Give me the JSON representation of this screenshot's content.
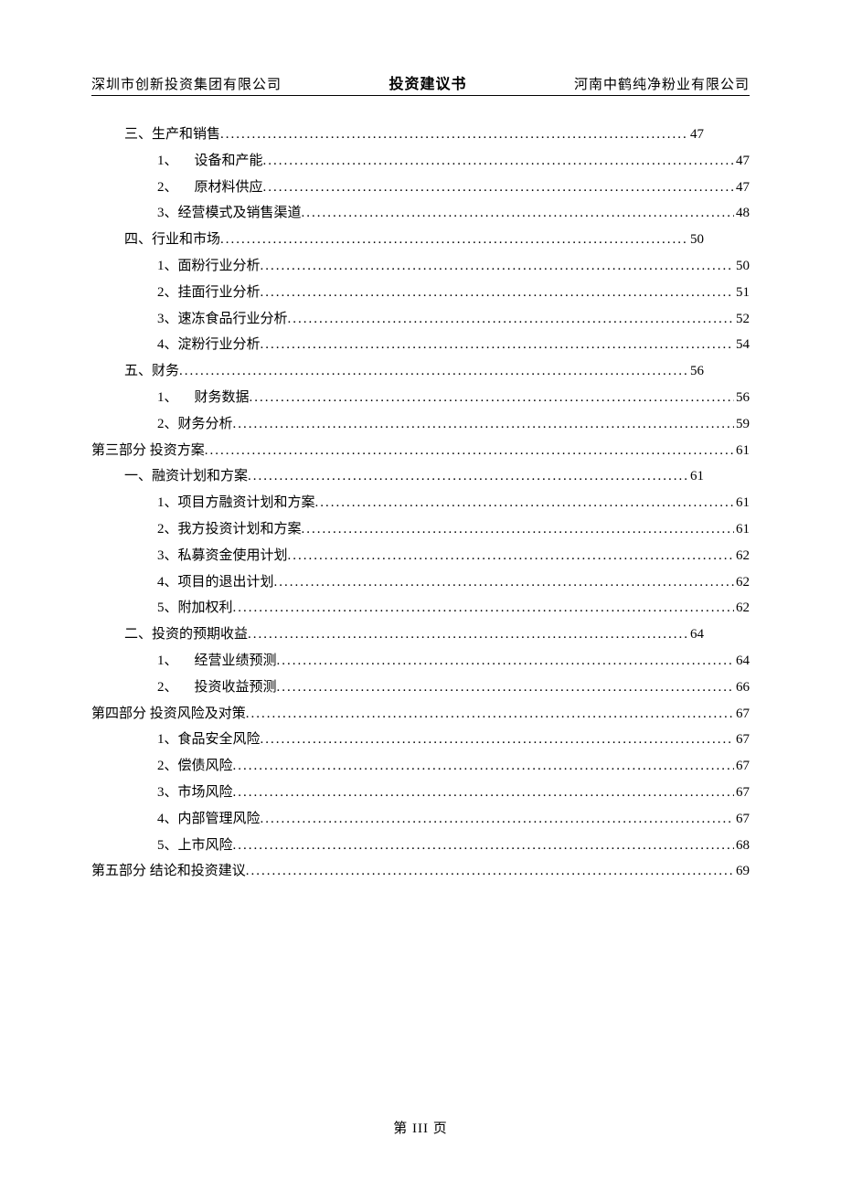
{
  "header": {
    "left": "深圳市创新投资集团有限公司",
    "center": "投资建议书",
    "right": "河南中鹤纯净粉业有限公司"
  },
  "toc": [
    {
      "indent": 1,
      "short": true,
      "label": "三、生产和销售",
      "page": "47"
    },
    {
      "indent": 2,
      "short": false,
      "sep": true,
      "label_prefix": "1、",
      "label": "设备和产能",
      "page": "47"
    },
    {
      "indent": 2,
      "short": false,
      "sep": true,
      "label_prefix": "2、",
      "label": "原材料供应",
      "page": "47"
    },
    {
      "indent": 2,
      "short": false,
      "label": "3、经营模式及销售渠道",
      "page": "48"
    },
    {
      "indent": 1,
      "short": true,
      "label": "四、行业和市场",
      "page": "50"
    },
    {
      "indent": 2,
      "short": false,
      "label": "1、面粉行业分析",
      "page": "50"
    },
    {
      "indent": 2,
      "short": false,
      "label": "2、挂面行业分析",
      "page": "51"
    },
    {
      "indent": 2,
      "short": false,
      "label": "3、速冻食品行业分析",
      "page": "52"
    },
    {
      "indent": 2,
      "short": false,
      "label": "4、淀粉行业分析",
      "page": "54"
    },
    {
      "indent": 1,
      "short": true,
      "label": "五、财务",
      "page": "56"
    },
    {
      "indent": 2,
      "short": false,
      "sep": true,
      "label_prefix": "1、",
      "label": "财务数据",
      "page": "56"
    },
    {
      "indent": 2,
      "short": false,
      "label": "2、财务分析",
      "page": "59"
    },
    {
      "indent": 0,
      "short": false,
      "label": "第三部分  投资方案",
      "page": "61"
    },
    {
      "indent": 1,
      "short": true,
      "label": "一、融资计划和方案",
      "page": "61"
    },
    {
      "indent": 2,
      "short": false,
      "label": "1、项目方融资计划和方案",
      "page": "61"
    },
    {
      "indent": 2,
      "short": false,
      "label": "2、我方投资计划和方案",
      "page": "61"
    },
    {
      "indent": 2,
      "short": false,
      "label": "3、私募资金使用计划",
      "page": "62"
    },
    {
      "indent": 2,
      "short": false,
      "label": "4、项目的退出计划",
      "page": "62"
    },
    {
      "indent": 2,
      "short": false,
      "label": "5、附加权利",
      "page": "62"
    },
    {
      "indent": 1,
      "short": true,
      "label": "二、投资的预期收益",
      "page": "64"
    },
    {
      "indent": 2,
      "short": false,
      "sep": true,
      "label_prefix": "1、",
      "label": "经营业绩预测",
      "page": "64"
    },
    {
      "indent": 2,
      "short": false,
      "sep": true,
      "label_prefix": "2、",
      "label": "投资收益预测",
      "page": "66"
    },
    {
      "indent": 0,
      "short": false,
      "label": "第四部分  投资风险及对策",
      "page": "67"
    },
    {
      "indent": 2,
      "short": false,
      "label": "1、食品安全风险",
      "page": "67"
    },
    {
      "indent": 2,
      "short": false,
      "label": "2、偿债风险",
      "page": "67"
    },
    {
      "indent": 2,
      "short": false,
      "label": "3、市场风险",
      "page": "67"
    },
    {
      "indent": 2,
      "short": false,
      "label": "4、内部管理风险",
      "page": "67"
    },
    {
      "indent": 2,
      "short": false,
      "label": "5、上市风险",
      "page": "68"
    },
    {
      "indent": 0,
      "short": false,
      "label": "第五部分  结论和投资建议",
      "page": "69"
    }
  ],
  "footer": "第 III 页"
}
